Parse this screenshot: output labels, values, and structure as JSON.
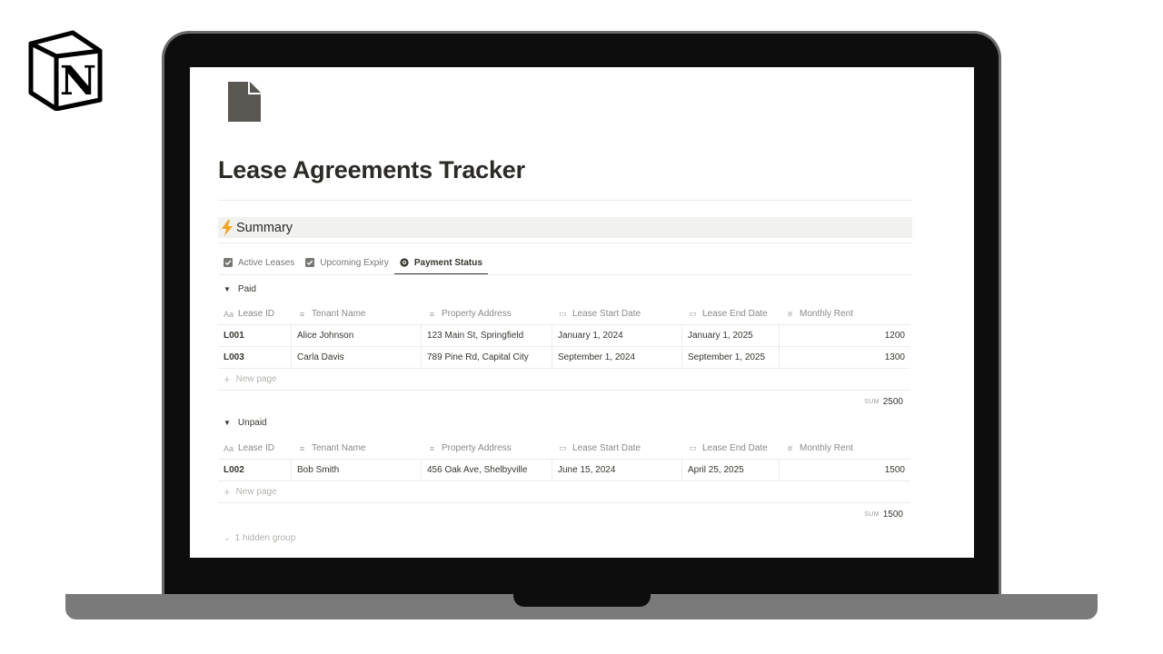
{
  "logo": {
    "letter": "N"
  },
  "page": {
    "title": "Lease Agreements Tracker",
    "callout": "Summary"
  },
  "tabs": [
    {
      "label": "Active Leases",
      "icon": "checkbox-icon"
    },
    {
      "label": "Upcoming Expiry",
      "icon": "checkbox-icon"
    },
    {
      "label": "Payment Status",
      "icon": "status-icon"
    }
  ],
  "columns": [
    "Lease ID",
    "Tenant Name",
    "Property Address",
    "Lease Start Date",
    "Lease End Date",
    "Monthly Rent"
  ],
  "groups": [
    {
      "name": "Paid",
      "rows": [
        {
          "id": "L001",
          "tenant": "Alice Johnson",
          "address": "123 Main St, Springfield",
          "start": "January 1, 2024",
          "end": "January 1, 2025",
          "rent": "1200"
        },
        {
          "id": "L003",
          "tenant": "Carla Davis",
          "address": "789 Pine Rd, Capital City",
          "start": "September 1, 2024",
          "end": "September 1, 2025",
          "rent": "1300"
        }
      ],
      "sum": "2500"
    },
    {
      "name": "Unpaid",
      "rows": [
        {
          "id": "L002",
          "tenant": "Bob Smith",
          "address": "456 Oak Ave, Shelbyville",
          "start": "June 15, 2024",
          "end": "April 25, 2025",
          "rent": "1500"
        }
      ],
      "sum": "1500"
    }
  ],
  "new_page_label": "New page",
  "sum_label": "SUM",
  "hidden_group_label": "1 hidden group",
  "colors": {
    "callout_bg": "#f1f1ef",
    "text": "#37352f",
    "muted": "#787774",
    "laptop_frame": "#0d0d0d",
    "laptop_base": "#7a7a7a"
  }
}
